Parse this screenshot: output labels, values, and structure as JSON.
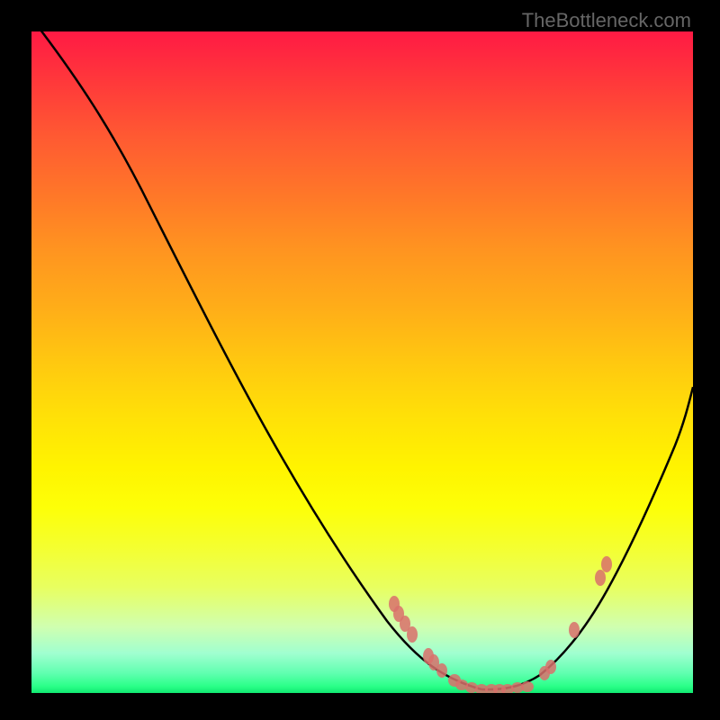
{
  "watermark": "TheBottleneck.com",
  "chart_data": {
    "type": "line",
    "title": "",
    "xlabel": "",
    "ylabel": "",
    "xlim": [
      0,
      1
    ],
    "ylim": [
      0,
      1
    ],
    "series": [
      {
        "name": "left-curve",
        "x": [
          0.0,
          0.06,
          0.12,
          0.18,
          0.24,
          0.3,
          0.36,
          0.42,
          0.48,
          0.54,
          0.6,
          0.64,
          0.68
        ],
        "y": [
          1.02,
          0.94,
          0.84,
          0.73,
          0.62,
          0.51,
          0.4,
          0.3,
          0.2,
          0.12,
          0.05,
          0.015,
          0.005
        ]
      },
      {
        "name": "right-curve",
        "x": [
          0.68,
          0.72,
          0.76,
          0.8,
          0.84,
          0.88,
          0.92,
          0.96,
          1.0
        ],
        "y": [
          0.005,
          0.01,
          0.03,
          0.07,
          0.13,
          0.21,
          0.31,
          0.42,
          0.55
        ]
      }
    ],
    "markers": [
      {
        "x": 0.548,
        "y": 0.135
      },
      {
        "x": 0.555,
        "y": 0.12
      },
      {
        "x": 0.565,
        "y": 0.105
      },
      {
        "x": 0.575,
        "y": 0.088
      },
      {
        "x": 0.6,
        "y": 0.055
      },
      {
        "x": 0.608,
        "y": 0.047
      },
      {
        "x": 0.62,
        "y": 0.035
      },
      {
        "x": 0.64,
        "y": 0.02
      },
      {
        "x": 0.65,
        "y": 0.012
      },
      {
        "x": 0.665,
        "y": 0.008
      },
      {
        "x": 0.68,
        "y": 0.006
      },
      {
        "x": 0.695,
        "y": 0.006
      },
      {
        "x": 0.708,
        "y": 0.005
      },
      {
        "x": 0.72,
        "y": 0.006
      },
      {
        "x": 0.735,
        "y": 0.008
      },
      {
        "x": 0.75,
        "y": 0.01
      },
      {
        "x": 0.775,
        "y": 0.03
      },
      {
        "x": 0.785,
        "y": 0.04
      },
      {
        "x": 0.82,
        "y": 0.095
      },
      {
        "x": 0.86,
        "y": 0.175
      },
      {
        "x": 0.87,
        "y": 0.195
      }
    ],
    "colors": {
      "curve": "#000000",
      "marker": "#d9706b",
      "border": "#000000"
    }
  }
}
